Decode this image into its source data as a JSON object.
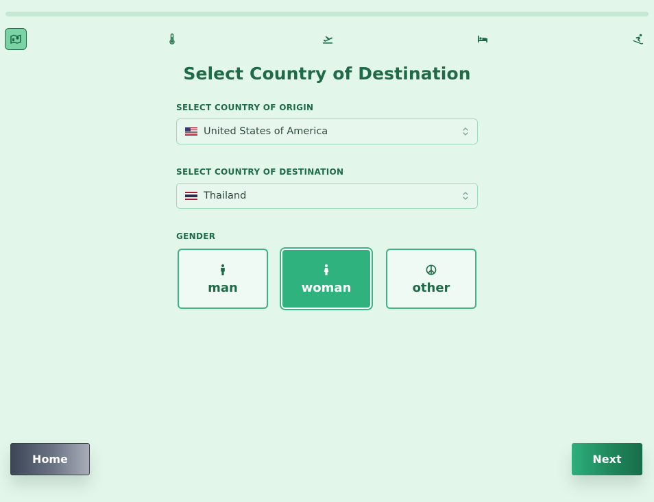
{
  "progress": {
    "fraction": 0
  },
  "steps": [
    {
      "icon": "map-icon",
      "active": true
    },
    {
      "icon": "thermometer-icon",
      "active": false
    },
    {
      "icon": "plane-departure-icon",
      "active": false
    },
    {
      "icon": "bed-icon",
      "active": false
    },
    {
      "icon": "skiing-icon",
      "active": false
    }
  ],
  "page": {
    "title": "Select Country of Destination"
  },
  "origin": {
    "label": "SELECT COUNTRY OF ORIGIN",
    "value": "United States of America",
    "flag": "us-flag-icon"
  },
  "destination": {
    "label": "SELECT COUNTRY OF DESTINATION",
    "value": "Thailand",
    "flag": "thai-flag-icon"
  },
  "gender": {
    "label": "GENDER",
    "selected": "woman",
    "options": [
      {
        "label": "man",
        "icon": "male-person-icon"
      },
      {
        "label": "woman",
        "icon": "female-person-icon"
      },
      {
        "label": "other",
        "icon": "peace-sign-icon"
      }
    ]
  },
  "nav": {
    "home_label": "Home",
    "next_label": "Next"
  },
  "colors": {
    "background": "#e3f6ea",
    "accent": "#2fb27d",
    "dark_green": "#1f6b48",
    "progress_track": "#c4e8d3"
  }
}
